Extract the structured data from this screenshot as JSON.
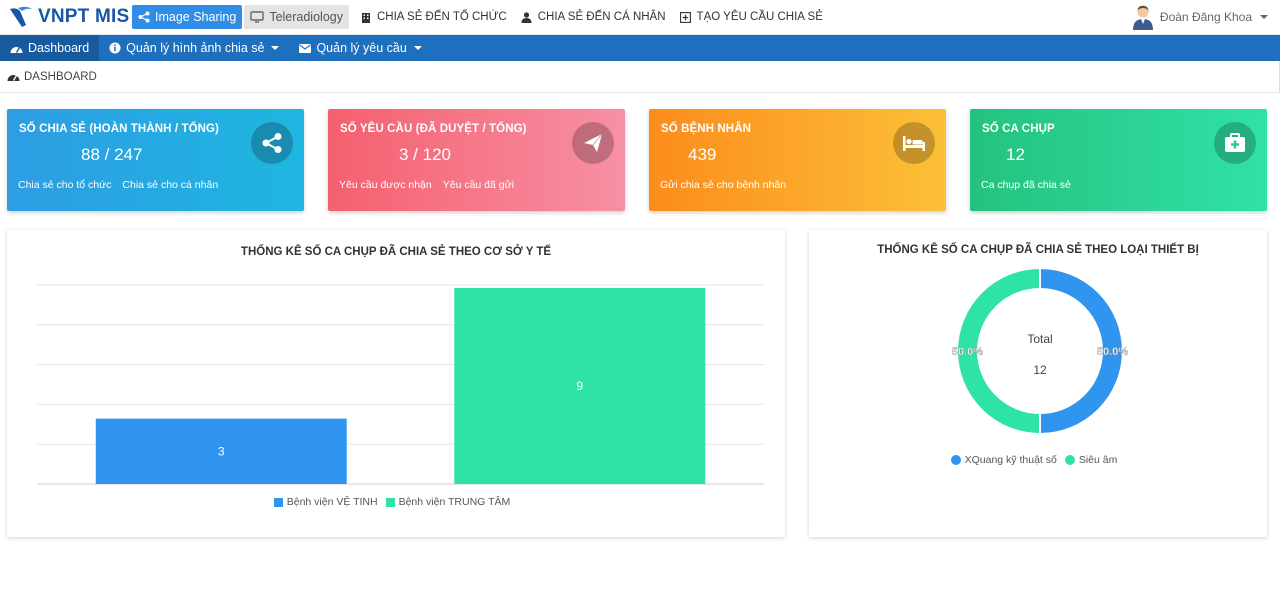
{
  "header": {
    "app_name": "VNPT MIS",
    "tabs": [
      {
        "label": "Image Sharing",
        "active": true
      },
      {
        "label": "Teleradiology",
        "active": false
      }
    ],
    "menu": [
      {
        "label": "CHIA SẺ ĐẾN TỔ CHỨC",
        "icon": "building-icon"
      },
      {
        "label": "CHIA SẺ ĐẾN CÁ NHÂN",
        "icon": "person-icon"
      },
      {
        "label": "TẠO YÊU CẦU CHIA SẺ",
        "icon": "plus-square-icon"
      }
    ],
    "user_name": "Đoàn Đăng Khoa"
  },
  "nav": {
    "items": [
      {
        "label": "Dashboard",
        "icon": "dashboard-icon"
      },
      {
        "label": "Quản lý hình ảnh chia sẻ",
        "icon": "info-icon"
      },
      {
        "label": "Quản lý yêu cầu",
        "icon": "envelope-icon"
      }
    ]
  },
  "breadcrumb": "DASHBOARD",
  "cards": [
    {
      "title": "SỐ CHIA SẺ (HOÀN THÀNH / TỔNG)",
      "value": "88 / 247",
      "links": [
        "Chia sẻ cho tổ chức",
        "Chia sẻ cho cá nhân"
      ],
      "icon": "share-icon"
    },
    {
      "title": "SỐ YÊU CẦU (ĐÃ DUYỆT / TỔNG)",
      "value": "3 / 120",
      "links": [
        "Yêu cầu được nhận",
        "Yêu cầu đã gửi"
      ],
      "icon": "paper-plane-icon"
    },
    {
      "title": "SỐ BỆNH NHÂN",
      "value": "439",
      "links": [
        "Gửi chia sẻ cho bệnh nhân"
      ],
      "icon": "bed-icon"
    },
    {
      "title": "SỐ CA CHỤP",
      "value": "12",
      "links": [
        "Ca chụp đã chia sẻ"
      ],
      "icon": "medkit-icon"
    }
  ],
  "colors": {
    "blue": "#2f95ee",
    "green": "#2ee3a3"
  },
  "chart_data": [
    {
      "type": "bar",
      "title": "THỐNG KÊ SỐ CA CHỤP ĐÃ CHIA SẺ THEO CƠ SỞ Y TẾ",
      "series": [
        {
          "name": "Bệnh viện VỆ TINH",
          "values": [
            3
          ],
          "color": "#2f95ee"
        },
        {
          "name": "Bệnh viện TRUNG TÂM",
          "values": [
            9
          ],
          "color": "#2ee3a3"
        }
      ],
      "ylim": [
        0,
        9
      ],
      "grid": true,
      "legend": "bottom"
    },
    {
      "type": "pie",
      "title": "THỐNG KÊ SỐ CA CHỤP ĐÃ CHIA SẺ THEO LOẠI THIẾT BỊ",
      "center_label": "Total",
      "center_value": "12",
      "slices": [
        {
          "name": "XQuang kỹ thuật số",
          "value": 6,
          "percent_label": "50.0%",
          "color": "#2f95ee"
        },
        {
          "name": "Siêu âm",
          "value": 6,
          "percent_label": "50.0%",
          "color": "#2ee3a3"
        }
      ],
      "legend": "bottom"
    }
  ]
}
